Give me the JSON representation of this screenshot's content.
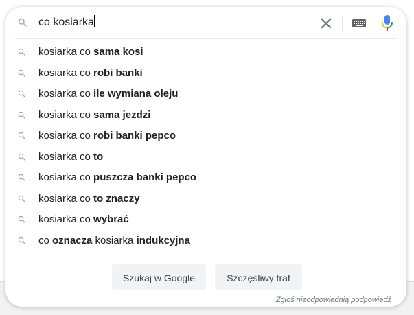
{
  "search": {
    "query": "co kosiarka",
    "icon": "search-icon",
    "clear_icon": "close-icon",
    "keyboard_icon": "keyboard-icon",
    "mic_icon": "microphone-icon"
  },
  "suggestions": [
    {
      "parts": [
        {
          "text": "kosiarka co ",
          "bold": false
        },
        {
          "text": "sama kosi",
          "bold": true
        }
      ]
    },
    {
      "parts": [
        {
          "text": "kosiarka co ",
          "bold": false
        },
        {
          "text": "robi banki",
          "bold": true
        }
      ]
    },
    {
      "parts": [
        {
          "text": "kosiarka co ",
          "bold": false
        },
        {
          "text": "ile wymiana oleju",
          "bold": true
        }
      ]
    },
    {
      "parts": [
        {
          "text": "kosiarka co ",
          "bold": false
        },
        {
          "text": "sama jezdzi",
          "bold": true
        }
      ]
    },
    {
      "parts": [
        {
          "text": "kosiarka co ",
          "bold": false
        },
        {
          "text": "robi banki pepco",
          "bold": true
        }
      ]
    },
    {
      "parts": [
        {
          "text": "kosiarka co ",
          "bold": false
        },
        {
          "text": "to",
          "bold": true
        }
      ]
    },
    {
      "parts": [
        {
          "text": "kosiarka co ",
          "bold": false
        },
        {
          "text": "puszcza banki pepco",
          "bold": true
        }
      ]
    },
    {
      "parts": [
        {
          "text": "kosiarka co ",
          "bold": false
        },
        {
          "text": "to znaczy",
          "bold": true
        }
      ]
    },
    {
      "parts": [
        {
          "text": "kosiarka co ",
          "bold": false
        },
        {
          "text": "wybrać",
          "bold": true
        }
      ]
    },
    {
      "parts": [
        {
          "text": "co ",
          "bold": false
        },
        {
          "text": "oznacza",
          "bold": true
        },
        {
          "text": " kosiarka ",
          "bold": false
        },
        {
          "text": "indukcyjna",
          "bold": true
        }
      ]
    }
  ],
  "buttons": {
    "search_label": "Szukaj w Google",
    "lucky_label": "Szczęśliwy traf"
  },
  "report_link": "Zgłoś nieodpowiednią podpowiedź",
  "colors": {
    "text": "#202124",
    "icon_gray": "#9aa0a6",
    "button_bg": "#f1f3f4",
    "mic_blue": "#4285f4",
    "mic_red": "#ea4335",
    "mic_yellow": "#fbbc04",
    "mic_green": "#34a853"
  }
}
